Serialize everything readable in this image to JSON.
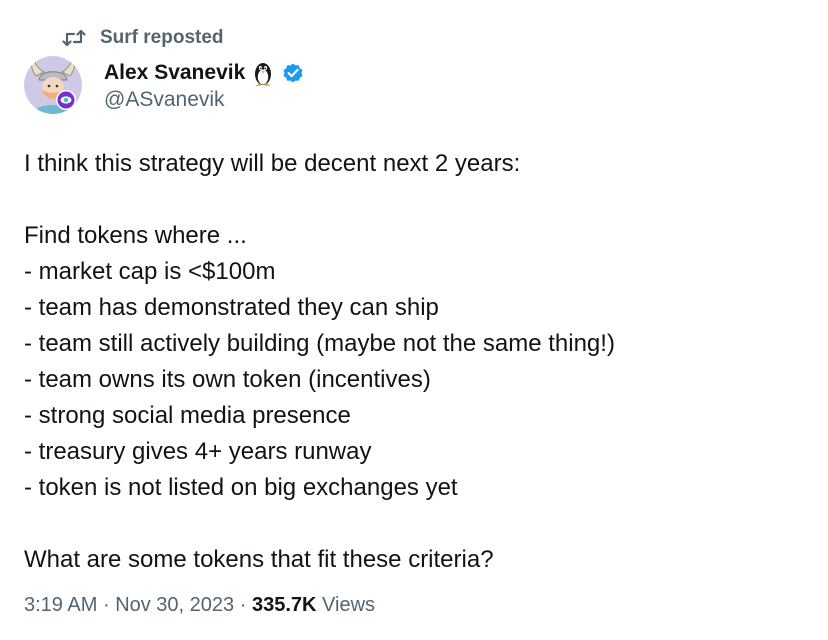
{
  "repost": {
    "text": "Surf reposted",
    "icon": "repost-icon"
  },
  "author": {
    "display_name": "Alex Svanevik",
    "name_emoji": "penguin-icon",
    "verified": true,
    "verified_color": "#1d9bf0",
    "handle": "@ASvanevik",
    "avatar": "avatar-viking-illustration"
  },
  "tweet": {
    "lines": [
      "I think this strategy will be decent next 2 years:",
      "",
      "Find tokens where ...",
      "- market cap is <$100m",
      "- team has demonstrated they can ship",
      "- team still actively building (maybe not the same thing!)",
      "- team owns its own token (incentives)",
      "- strong social media presence",
      "- treasury gives 4+ years runway",
      "- token is not listed on big exchanges yet",
      "",
      "What are some tokens that fit these criteria?"
    ]
  },
  "meta": {
    "time": "3:19 AM",
    "separator": "·",
    "date": "Nov 30, 2023",
    "views_count": "335.7K",
    "views_label": "Views"
  },
  "colors": {
    "text_primary": "#0f1419",
    "text_secondary": "#536471",
    "verified_blue": "#1d9bf0"
  }
}
